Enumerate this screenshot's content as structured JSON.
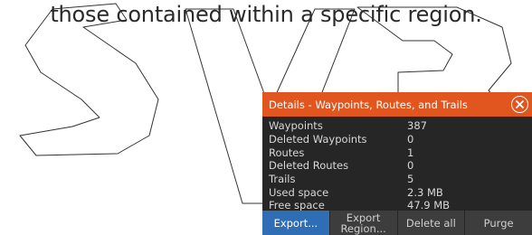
{
  "page": {
    "caption": "those contained within a specific region.",
    "watermark_text": "SVB"
  },
  "dialog": {
    "title": "Details - Waypoints, Routes, and Trails",
    "close_icon": "close-icon",
    "rows": [
      {
        "label": "Waypoints",
        "value": "387"
      },
      {
        "label": "Deleted Waypoints",
        "value": "0"
      },
      {
        "label": "Routes",
        "value": "1"
      },
      {
        "label": "Deleted Routes",
        "value": "0"
      },
      {
        "label": "Trails",
        "value": "5"
      },
      {
        "label": "Used space",
        "value": "2.3 MB"
      },
      {
        "label": "Free space",
        "value": "47.9 MB"
      }
    ],
    "buttons": {
      "export": "Export...",
      "export_region_line1": "Export",
      "export_region_line2": "Region...",
      "delete_all": "Delete all",
      "purge": "Purge"
    }
  },
  "colors": {
    "title_bar": "#e0561e",
    "dialog_bg": "#262626",
    "button_bg": "#3d3d3d",
    "primary_button": "#2f6db5"
  }
}
